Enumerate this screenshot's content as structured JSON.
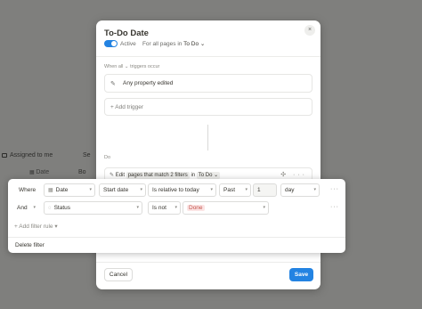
{
  "background": {
    "assigned_label": "Assigned to me",
    "search_fragment": "Se",
    "date_column": "Date",
    "b_fragment": "Bo"
  },
  "modal": {
    "title": "To-Do Date",
    "close_icon": "×",
    "active_label": "Active",
    "scope_prefix": "For all pages in",
    "scope_db": "To Do",
    "trigger_section": "When all ⌄ triggers occur",
    "trigger_item": "Any property edited",
    "add_trigger": "+ Add trigger",
    "do_label": "Do",
    "action": {
      "edit": "Edit",
      "filter_chip": "pages that match 2 filters",
      "in": "in",
      "db": "To Do"
    },
    "cancel": "Cancel",
    "save": "Save"
  },
  "filter": {
    "rows": [
      {
        "conj": "Where",
        "property": "Date",
        "date_part": "Start date",
        "operator": "Is relative to today",
        "direction": "Past",
        "amount": "1",
        "unit": "day"
      },
      {
        "conj": "And",
        "property": "Status",
        "operator": "Is not",
        "value": "Done"
      }
    ],
    "add_rule": "Add filter rule",
    "delete": "Delete filter"
  },
  "colors": {
    "accent": "#2383e2",
    "tag_bg": "#fbe4e4",
    "tag_text": "#c4554d"
  }
}
